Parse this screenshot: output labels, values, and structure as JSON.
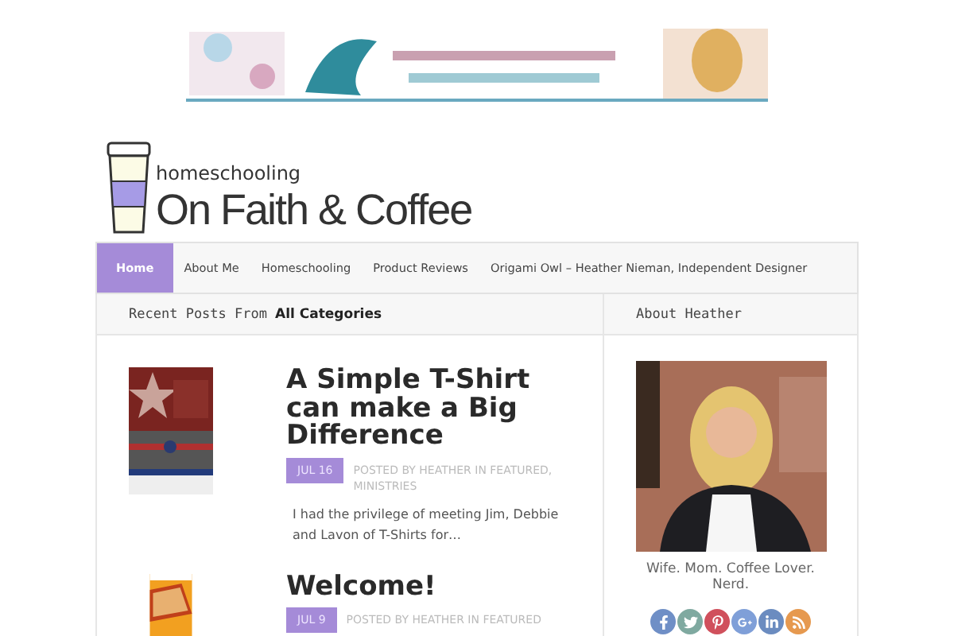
{
  "logo": {
    "tagline": "homeschooling",
    "title": "On Faith & Coffee"
  },
  "nav": [
    {
      "label": "Home",
      "selected": true
    },
    {
      "label": "About Me",
      "selected": false
    },
    {
      "label": "Homeschooling",
      "selected": false
    },
    {
      "label": "Product Reviews",
      "selected": false
    },
    {
      "label": "Origami Owl – Heather Nieman, Independent Designer",
      "selected": false
    }
  ],
  "recent": {
    "label": "Recent Posts From",
    "category": "All Categories"
  },
  "posts": [
    {
      "title": "A Simple T-Shirt can make a Big Difference",
      "date": "JUL 16",
      "meta": "POSTED BY HEATHER IN FEATURED, MINISTRIES",
      "excerpt": "I had the privilege of meeting Jim, Debbie and Lavon of T-Shirts for…"
    },
    {
      "title": "Welcome!",
      "date": "JUL 9",
      "meta": "POSTED BY HEATHER IN FEATURED"
    }
  ],
  "sidebar": {
    "heading": "About Heather",
    "caption": "Wife. Mom. Coffee Lover. Nerd.",
    "social": [
      {
        "color": "#6f8fc6"
      },
      {
        "color": "#7fa9a0"
      },
      {
        "color": "#d0505c"
      },
      {
        "color": "#7f9fd8"
      },
      {
        "color": "#6b8cc0"
      },
      {
        "color": "#e6994f"
      }
    ]
  }
}
